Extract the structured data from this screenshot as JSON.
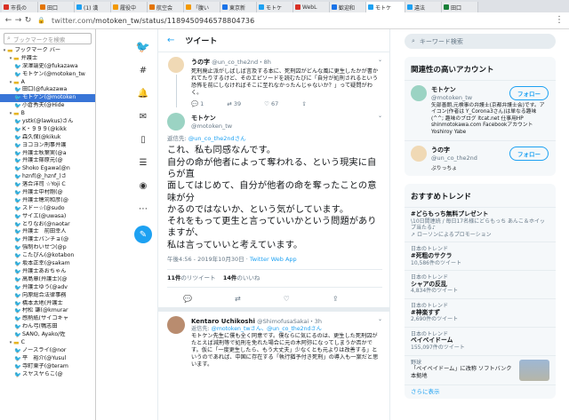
{
  "browser": {
    "tabs": [
      {
        "label": "市長の",
        "color": "#d93025"
      },
      {
        "label": "田口",
        "color": "#e37400"
      },
      {
        "label": "(1) 漢",
        "color": "#1da1f2"
      },
      {
        "label": "履役中",
        "color": "#f29900"
      },
      {
        "label": "航空会",
        "color": "#e37400"
      },
      {
        "label": "「腹い",
        "color": "#f29900"
      },
      {
        "label": "東京新",
        "color": "#1a73e8"
      },
      {
        "label": "モトケ",
        "color": "#1da1f2"
      },
      {
        "label": "WebL",
        "color": "#d93025"
      },
      {
        "label": "歓迎和",
        "color": "#1a73e8"
      },
      {
        "label": "モトケ",
        "color": "#1da1f2"
      },
      {
        "label": "違法",
        "color": "#1da1f2"
      },
      {
        "label": "田口",
        "color": "#188038"
      }
    ],
    "url_host": "twitter.com",
    "url_path": "/motoken_tw/status/1189450946578804736"
  },
  "bookmarks": {
    "search_placeholder": "ブックマークを検索",
    "rows": [
      {
        "type": "folder",
        "indent": 0,
        "label": "ブックマーク バー",
        "exp": "▾"
      },
      {
        "type": "folder",
        "indent": 1,
        "label": "弁護士",
        "exp": "▾"
      },
      {
        "type": "tw",
        "indent": 2,
        "label": "深澤諭史(@fukazawa"
      },
      {
        "type": "tw",
        "indent": 2,
        "label": "モトケン(@motoken_tw"
      },
      {
        "type": "folder",
        "indent": 1,
        "label": "A",
        "exp": "▾"
      },
      {
        "type": "tw",
        "indent": 2,
        "label": "田口(@fukazawa"
      },
      {
        "type": "tw",
        "indent": 2,
        "label": "モトケン(@motoken",
        "selected": true
      },
      {
        "type": "tw",
        "indent": 2,
        "label": "小倉秀夫(@Hide"
      },
      {
        "type": "folder",
        "indent": 1,
        "label": "B",
        "exp": "▾"
      },
      {
        "type": "tw",
        "indent": 2,
        "label": "ystk(@lawkus)さん"
      },
      {
        "type": "tw",
        "indent": 2,
        "label": "K・９９９(@kikk"
      },
      {
        "type": "tw",
        "indent": 2,
        "label": "森久保(@kikuk"
      },
      {
        "type": "tw",
        "indent": 2,
        "label": "ヨコヨン刑事弁護"
      },
      {
        "type": "tw",
        "indent": 2,
        "label": "弁護士秋葉実(@a"
      },
      {
        "type": "tw",
        "indent": 2,
        "label": "弁護士篠原元(@"
      },
      {
        "type": "tw",
        "indent": 2,
        "label": "Shoko Egawa(@n"
      },
      {
        "type": "tw",
        "indent": 2,
        "label": "hznf(@_hznf_)さ"
      },
      {
        "type": "tw",
        "indent": 2,
        "label": "落合洋司 ☆Yoji C"
      },
      {
        "type": "tw",
        "indent": 2,
        "label": "弁護士中村剛(@"
      },
      {
        "type": "tw",
        "indent": 2,
        "label": "弁護士穂苅和彦(@"
      },
      {
        "type": "tw",
        "indent": 2,
        "label": "スドー☆(@sudo"
      },
      {
        "type": "tw",
        "indent": 2,
        "label": "サイエ(@uwasa)"
      },
      {
        "type": "tw",
        "indent": 2,
        "label": "とりなお(@naotar"
      },
      {
        "type": "tw",
        "indent": 2,
        "label": "弁護士　前田幸人"
      },
      {
        "type": "tw",
        "indent": 2,
        "label": "弁護士パンチョ(@"
      },
      {
        "type": "tw",
        "indent": 2,
        "label": "強制わいせつ(@p"
      },
      {
        "type": "tw",
        "indent": 2,
        "label": "こたぴん(@kotabon"
      },
      {
        "type": "tw",
        "indent": 2,
        "label": "坂本正幸(@sakam"
      },
      {
        "type": "tw",
        "indent": 2,
        "label": "弁護士あおちゃん"
      },
      {
        "type": "tw",
        "indent": 2,
        "label": "高島章(弁護士)(@"
      },
      {
        "type": "tw",
        "indent": 2,
        "label": "弁護士ゆう(@adv"
      },
      {
        "type": "tw",
        "indent": 2,
        "label": "向原総合法律事務"
      },
      {
        "type": "tw",
        "indent": 2,
        "label": "橋本太地(弁護士"
      },
      {
        "type": "tw",
        "indent": 2,
        "label": "村松 謙(@kmurar"
      },
      {
        "type": "tw",
        "indent": 2,
        "label": "感熱紙(サイコキャ"
      },
      {
        "type": "tw",
        "indent": 2,
        "label": "わん弓(鴨志田"
      },
      {
        "type": "tw",
        "indent": 2,
        "label": "SANO, Ayako/佐"
      },
      {
        "type": "folder",
        "indent": 1,
        "label": "C",
        "exp": "▾"
      },
      {
        "type": "tw",
        "indent": 2,
        "label": "ノースライ(@nor"
      },
      {
        "type": "tw",
        "indent": 2,
        "label": "平　裕介(@Yusul"
      },
      {
        "type": "tw",
        "indent": 2,
        "label": "寺町東子(@teram"
      },
      {
        "type": "tw",
        "indent": 2,
        "label": "スヤスヤらこ(@"
      }
    ]
  },
  "twitter": {
    "header_title": "ツイート",
    "parent_tweet": {
      "name": "うの字",
      "handle": "@un_co_the2nd",
      "time": "・8h",
      "text": "死刑廃止派がしばしば言及する本に、死刑囚がどんな風に更生したかが書かれてたりするけど、そのエピソードを読むたびに「自分が処刑されるという恐怖を前にしなければそこに至れなかったんじゃないか？」って疑問がわく。",
      "replies": "1",
      "retweets": "39",
      "likes": "67"
    },
    "main_tweet": {
      "name": "モトケン",
      "handle": "@motoken_tw",
      "reply_to_label": "返信先: ",
      "reply_to_handle": "@un_co_the2ndさん",
      "text_lines": [
        "これ、私も同感なんです。",
        "自分の命が他者によって奪われる、という現実に自らが直",
        "面してはじめて、自分が他者の命を奪ったことの意味が分",
        "かるのではないか、という気がしています。",
        "それをもって更生と言っていいかという問題がありますが、",
        "私は言っていいと考えています。"
      ],
      "meta": "午後4:56 - 2019年10月30日 · ",
      "client": "Twitter Web App",
      "retweet_count": "11件",
      "retweet_label": "のリツイート",
      "like_count": "14件",
      "like_label": "のいいね"
    },
    "reply_tweet": {
      "name": "Kentaro Uchikoshi",
      "handle": "@ShimofusaSakai",
      "time": "・3h",
      "reply_to_label": "返信先: ",
      "reply_to_handle": "@motoken_twさん、@un_co_the2ndさん",
      "text": "モトケン先生に僕も全く同意です。僕ならに気にるのは、更生した死刑囚がたとえば減刑等で処刑を免れた場合に元の木阿弥になってしまうか否かです。仮に「一度更生したら、もう大丈夫」少なくとも元よりは改善する」というのであれば、中国に存在する「執行猶予付き死刑」の導入も一案だと思います。"
    }
  },
  "right": {
    "search_placeholder": "キーワード検索",
    "related_title": "関連性の高いアカウント",
    "accounts": [
      {
        "name": "モトケン",
        "handle": "@motoken_tw",
        "bio": "矢部善朗,元検事の弁護士(京都弁護士会)です。アイコン(作者は Y_Corona3さん)は単なる趣味(^^; 趣味のブログ ltcat.net 仕事用HP shinmotokawa.com FacebookアカウントYoshiroy Yabe",
        "follow": "フォロー"
      },
      {
        "name": "うの字",
        "handle": "@un_co_the2nd",
        "bio": "ぷりっちょ",
        "follow": "フォロー"
      }
    ],
    "trends_title": "おすすめトレンド",
    "trends": [
      {
        "tag": "#どらもっち無料プレゼント",
        "sub": "\\10日間連続 / 毎日17名様にどらもっち あんこ＆ホイップ当たる♪",
        "promo": "ローソンによるプロモーション"
      },
      {
        "cat": "日本のトレンド",
        "tag": "#死粗のサクラ",
        "sub": "10,586件のツイート"
      },
      {
        "cat": "日本のトレンド",
        "tag": "シャアの反乱",
        "sub": "4,834件のツイート"
      },
      {
        "cat": "日本のトレンド",
        "tag": "#神楽すず",
        "sub": "2,690件のツイート"
      },
      {
        "cat": "日本のトレンド",
        "tag": "ベイベイドーム",
        "sub": "155,097件のツイート"
      },
      {
        "cat": "野球",
        "tag": "「ペイペイドーム」に改称 ソフトバンク本拠地",
        "sub": ""
      }
    ],
    "more": "さらに表示"
  }
}
